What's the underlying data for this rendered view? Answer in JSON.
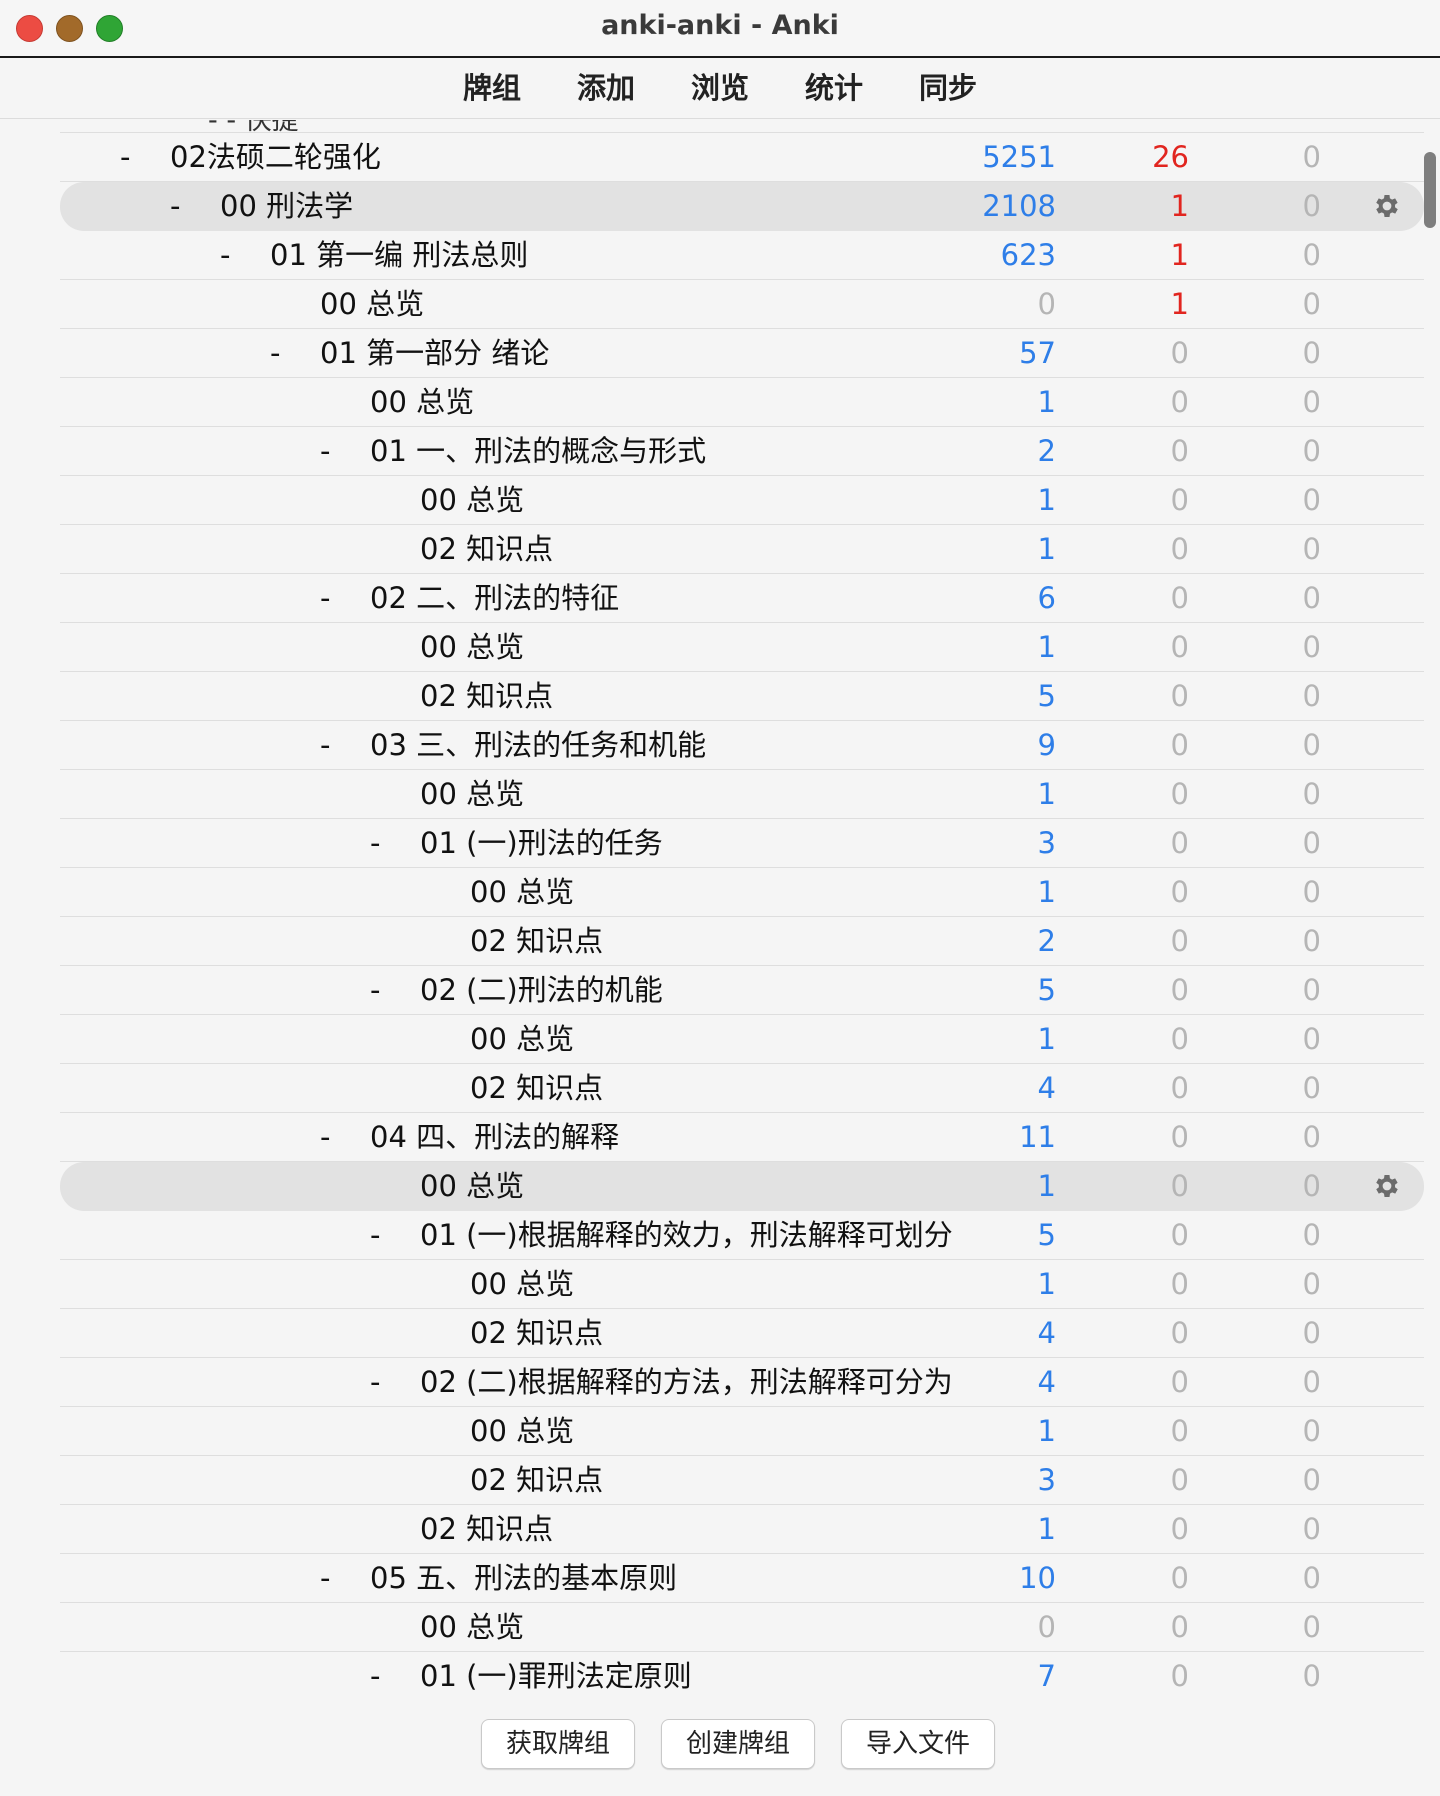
{
  "window": {
    "title": "anki-anki - Anki"
  },
  "toolbar": {
    "items": [
      "牌组",
      "添加",
      "浏览",
      "统计",
      "同步"
    ]
  },
  "clipped_row_text": "- - 快捷",
  "colors": {
    "new": "#2e7ee8",
    "learn": "#e1251f",
    "zero": "#b5b5b5",
    "highlight": "#e2e2e2"
  },
  "rows": [
    {
      "collapse": "-",
      "name": "02法硕二轮强化",
      "new": "5251",
      "learn": "26",
      "due": "0",
      "level": 0
    },
    {
      "collapse": "-",
      "name": "00 刑法学",
      "new": "2108",
      "learn": "1",
      "due": "0",
      "level": 1,
      "highlight": true,
      "gear": "gear-icon"
    },
    {
      "collapse": "-",
      "name": "01 第一编 刑法总则",
      "new": "623",
      "learn": "1",
      "due": "0",
      "level": 2
    },
    {
      "collapse": "",
      "name": "00 总览",
      "new": "0",
      "learn": "1",
      "due": "0",
      "level": 3
    },
    {
      "collapse": "-",
      "name": "01 第一部分 绪论",
      "new": "57",
      "learn": "0",
      "due": "0",
      "level": 3
    },
    {
      "collapse": "",
      "name": "00 总览",
      "new": "1",
      "learn": "0",
      "due": "0",
      "level": 4
    },
    {
      "collapse": "-",
      "name": "01 一、刑法的概念与形式",
      "new": "2",
      "learn": "0",
      "due": "0",
      "level": 4
    },
    {
      "collapse": "",
      "name": "00 总览",
      "new": "1",
      "learn": "0",
      "due": "0",
      "level": 5
    },
    {
      "collapse": "",
      "name": "02 知识点",
      "new": "1",
      "learn": "0",
      "due": "0",
      "level": 5
    },
    {
      "collapse": "-",
      "name": "02 二、刑法的特征",
      "new": "6",
      "learn": "0",
      "due": "0",
      "level": 4
    },
    {
      "collapse": "",
      "name": "00 总览",
      "new": "1",
      "learn": "0",
      "due": "0",
      "level": 5
    },
    {
      "collapse": "",
      "name": "02 知识点",
      "new": "5",
      "learn": "0",
      "due": "0",
      "level": 5
    },
    {
      "collapse": "-",
      "name": "03 三、刑法的任务和机能",
      "new": "9",
      "learn": "0",
      "due": "0",
      "level": 4
    },
    {
      "collapse": "",
      "name": "00 总览",
      "new": "1",
      "learn": "0",
      "due": "0",
      "level": 5
    },
    {
      "collapse": "-",
      "name": "01 (一)刑法的任务",
      "new": "3",
      "learn": "0",
      "due": "0",
      "level": 5
    },
    {
      "collapse": "",
      "name": "00 总览",
      "new": "1",
      "learn": "0",
      "due": "0",
      "level": 6
    },
    {
      "collapse": "",
      "name": "02 知识点",
      "new": "2",
      "learn": "0",
      "due": "0",
      "level": 6
    },
    {
      "collapse": "-",
      "name": "02 (二)刑法的机能",
      "new": "5",
      "learn": "0",
      "due": "0",
      "level": 5
    },
    {
      "collapse": "",
      "name": "00 总览",
      "new": "1",
      "learn": "0",
      "due": "0",
      "level": 6
    },
    {
      "collapse": "",
      "name": "02 知识点",
      "new": "4",
      "learn": "0",
      "due": "0",
      "level": 6
    },
    {
      "collapse": "-",
      "name": "04 四、刑法的解释",
      "new": "11",
      "learn": "0",
      "due": "0",
      "level": 4
    },
    {
      "collapse": "",
      "name": "00 总览",
      "new": "1",
      "learn": "0",
      "due": "0",
      "level": 5,
      "highlight": true,
      "gear": "gear-icon"
    },
    {
      "collapse": "-",
      "name": "01 (一)根据解释的效力，刑法解释可划分",
      "new": "5",
      "learn": "0",
      "due": "0",
      "level": 5
    },
    {
      "collapse": "",
      "name": "00 总览",
      "new": "1",
      "learn": "0",
      "due": "0",
      "level": 6
    },
    {
      "collapse": "",
      "name": "02 知识点",
      "new": "4",
      "learn": "0",
      "due": "0",
      "level": 6
    },
    {
      "collapse": "-",
      "name": "02 (二)根据解释的方法，刑法解释可分为",
      "new": "4",
      "learn": "0",
      "due": "0",
      "level": 5
    },
    {
      "collapse": "",
      "name": "00 总览",
      "new": "1",
      "learn": "0",
      "due": "0",
      "level": 6
    },
    {
      "collapse": "",
      "name": "02 知识点",
      "new": "3",
      "learn": "0",
      "due": "0",
      "level": 6
    },
    {
      "collapse": "",
      "name": "02 知识点",
      "new": "1",
      "learn": "0",
      "due": "0",
      "level": 5
    },
    {
      "collapse": "-",
      "name": "05 五、刑法的基本原则",
      "new": "10",
      "learn": "0",
      "due": "0",
      "level": 4
    },
    {
      "collapse": "",
      "name": "00 总览",
      "new": "0",
      "learn": "0",
      "due": "0",
      "level": 5
    },
    {
      "collapse": "-",
      "name": "01 (一)罪刑法定原则",
      "new": "7",
      "learn": "0",
      "due": "0",
      "level": 5
    }
  ],
  "bottom": {
    "get_shared": "获取牌组",
    "create_deck": "创建牌组",
    "import_file": "导入文件"
  }
}
